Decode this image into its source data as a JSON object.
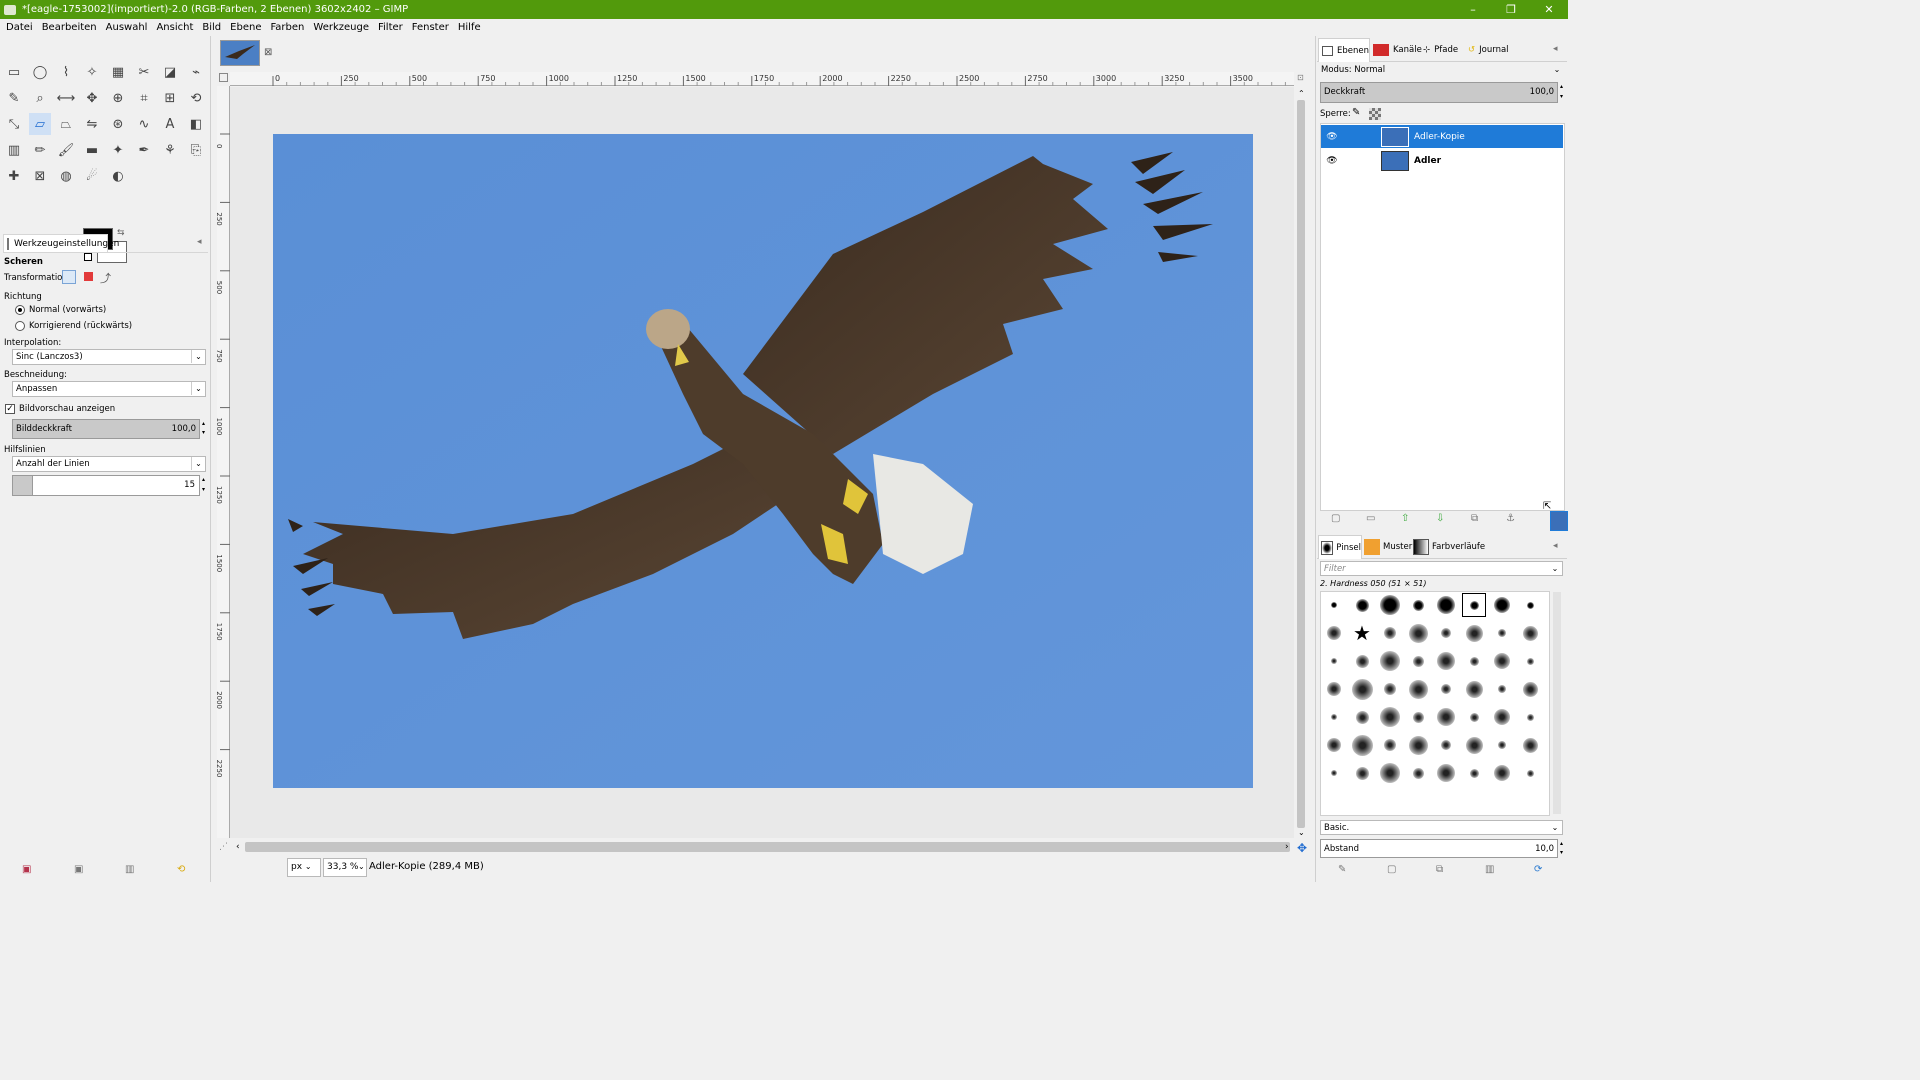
{
  "window": {
    "title": "*[eagle-1753002](importiert)-2.0 (RGB-Farben, 2 Ebenen) 3602x2402 – GIMP",
    "controls": [
      "–",
      "❐",
      "✕"
    ]
  },
  "menu": [
    "Datei",
    "Bearbeiten",
    "Auswahl",
    "Ansicht",
    "Bild",
    "Ebene",
    "Farben",
    "Werkzeuge",
    "Filter",
    "Fenster",
    "Hilfe"
  ],
  "tool_options": {
    "tab_label": "Werkzeugeinstellungen",
    "tool_name": "Scheren",
    "transformation_label": "Transformation:",
    "direction_label": "Richtung",
    "direction_normal": "Normal (vorwärts)",
    "direction_corrective": "Korrigierend (rückwärts)",
    "interpolation_label": "Interpolation:",
    "interpolation_value": "Sinc (Lanczos3)",
    "clipping_label": "Beschneidung:",
    "clipping_value": "Anpassen",
    "preview_label": "Bildvorschau anzeigen",
    "opacity_label": "Bilddeckkraft",
    "opacity_value": "100,0",
    "guides_label": "Hilfslinien",
    "guides_value": "Anzahl der Linien",
    "lines_value": "15"
  },
  "ruler": {
    "h_ticks": [
      "0",
      "250",
      "500",
      "750",
      "1000",
      "1250",
      "1500",
      "1750",
      "2000",
      "2250",
      "2500",
      "2750",
      "3000",
      "3250",
      "3500"
    ],
    "v_ticks": [
      "0",
      "250",
      "500",
      "750",
      "1000",
      "1250",
      "1500",
      "1750",
      "2000",
      "2250"
    ]
  },
  "status": {
    "unit": "px",
    "zoom": "33,3 %",
    "info": "Adler-Kopie (289,4 MB)"
  },
  "layers_panel": {
    "tabs": [
      "Ebenen",
      "Kanäle",
      "Pfade",
      "Journal"
    ],
    "mode_label": "Modus: Normal",
    "opacity_label": "Deckkraft",
    "opacity_value": "100,0",
    "lock_label": "Sperre:",
    "layers": [
      {
        "name": "Adler-Kopie",
        "selected": true
      },
      {
        "name": "Adler",
        "selected": false
      }
    ]
  },
  "brushes_panel": {
    "tabs": [
      "Pinsel",
      "Muster",
      "Farbverläufe"
    ],
    "filter_placeholder": "Filter",
    "brush_name": "2. Hardness 050 (51 × 51)",
    "preset": "Basic.",
    "spacing_label": "Abstand",
    "spacing_value": "10,0"
  },
  "colors": {
    "titlebar": "#529a0c",
    "selection": "#1f7bd8",
    "sky": "#5b8fd6"
  }
}
